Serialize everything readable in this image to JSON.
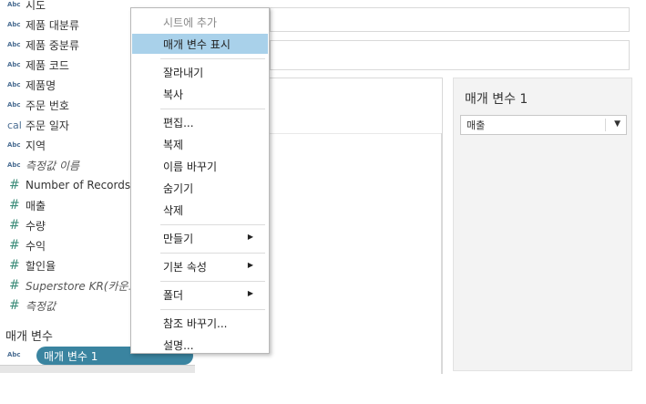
{
  "data_pane": {
    "fields": [
      {
        "type": "Abc",
        "kind": "dim",
        "name": "시도",
        "italic": false
      },
      {
        "type": "Abc",
        "kind": "dim",
        "name": "제품 대분류",
        "italic": false
      },
      {
        "type": "Abc",
        "kind": "dim",
        "name": "제품 중분류",
        "italic": false
      },
      {
        "type": "Abc",
        "kind": "dim",
        "name": "제품 코드",
        "italic": false
      },
      {
        "type": "Abc",
        "kind": "dim",
        "name": "제품명",
        "italic": false
      },
      {
        "type": "Abc",
        "kind": "dim",
        "name": "주문 번호",
        "italic": false
      },
      {
        "type": "cal",
        "kind": "date",
        "name": "주문 일자",
        "italic": false
      },
      {
        "type": "Abc",
        "kind": "dim",
        "name": "지역",
        "italic": false
      },
      {
        "type": "Abc",
        "kind": "dim",
        "name": "측정값 이름",
        "italic": true
      },
      {
        "type": "#",
        "kind": "measure",
        "name": "Number of Records",
        "italic": false
      },
      {
        "type": "#",
        "kind": "measure",
        "name": "매출",
        "italic": false
      },
      {
        "type": "#",
        "kind": "measure",
        "name": "수량",
        "italic": false
      },
      {
        "type": "#",
        "kind": "measure",
        "name": "수익",
        "italic": false
      },
      {
        "type": "#",
        "kind": "measure",
        "name": "할인율",
        "italic": false
      },
      {
        "type": "#",
        "kind": "measure",
        "name": "Superstore KR(카운트)",
        "italic": true
      },
      {
        "type": "#",
        "kind": "measure",
        "name": "측정값",
        "italic": true
      }
    ],
    "parameters_header": "매개 변수",
    "parameter": {
      "type": "Abc",
      "name": "매개 변수 1"
    }
  },
  "context_menu": {
    "items": [
      {
        "label": "시트에 추가",
        "disabled": true,
        "hover": false,
        "submenu": false
      },
      {
        "label": "매개 변수 표시",
        "disabled": false,
        "hover": true,
        "submenu": false
      },
      {
        "sep": true
      },
      {
        "label": "잘라내기",
        "disabled": false,
        "hover": false,
        "submenu": false
      },
      {
        "label": "복사",
        "disabled": false,
        "hover": false,
        "submenu": false
      },
      {
        "sep": true
      },
      {
        "label": "편집...",
        "disabled": false,
        "hover": false,
        "submenu": false
      },
      {
        "label": "복제",
        "disabled": false,
        "hover": false,
        "submenu": false
      },
      {
        "label": "이름 바꾸기",
        "disabled": false,
        "hover": false,
        "submenu": false
      },
      {
        "label": "숨기기",
        "disabled": false,
        "hover": false,
        "submenu": false
      },
      {
        "label": "삭제",
        "disabled": false,
        "hover": false,
        "submenu": false
      },
      {
        "sep": true
      },
      {
        "label": "만들기",
        "disabled": false,
        "hover": false,
        "submenu": true
      },
      {
        "sep": true
      },
      {
        "label": "기본 속성",
        "disabled": false,
        "hover": false,
        "submenu": true
      },
      {
        "sep": true
      },
      {
        "label": "폴더",
        "disabled": false,
        "hover": false,
        "submenu": true
      },
      {
        "sep": true
      },
      {
        "label": "참조 바꾸기...",
        "disabled": false,
        "hover": false,
        "submenu": false
      },
      {
        "label": "설명...",
        "disabled": false,
        "hover": false,
        "submenu": false
      }
    ],
    "submenu_arrow": "▶"
  },
  "param_card": {
    "title": "매개 변수 1",
    "selected_value": "매출",
    "dropdown_arrow": "▼"
  },
  "colors": {
    "hover": "#a9d1ea",
    "param_pill": "#3a84a0",
    "dim_icon": "#4b6e93",
    "measure_icon": "#3d8d7a"
  }
}
